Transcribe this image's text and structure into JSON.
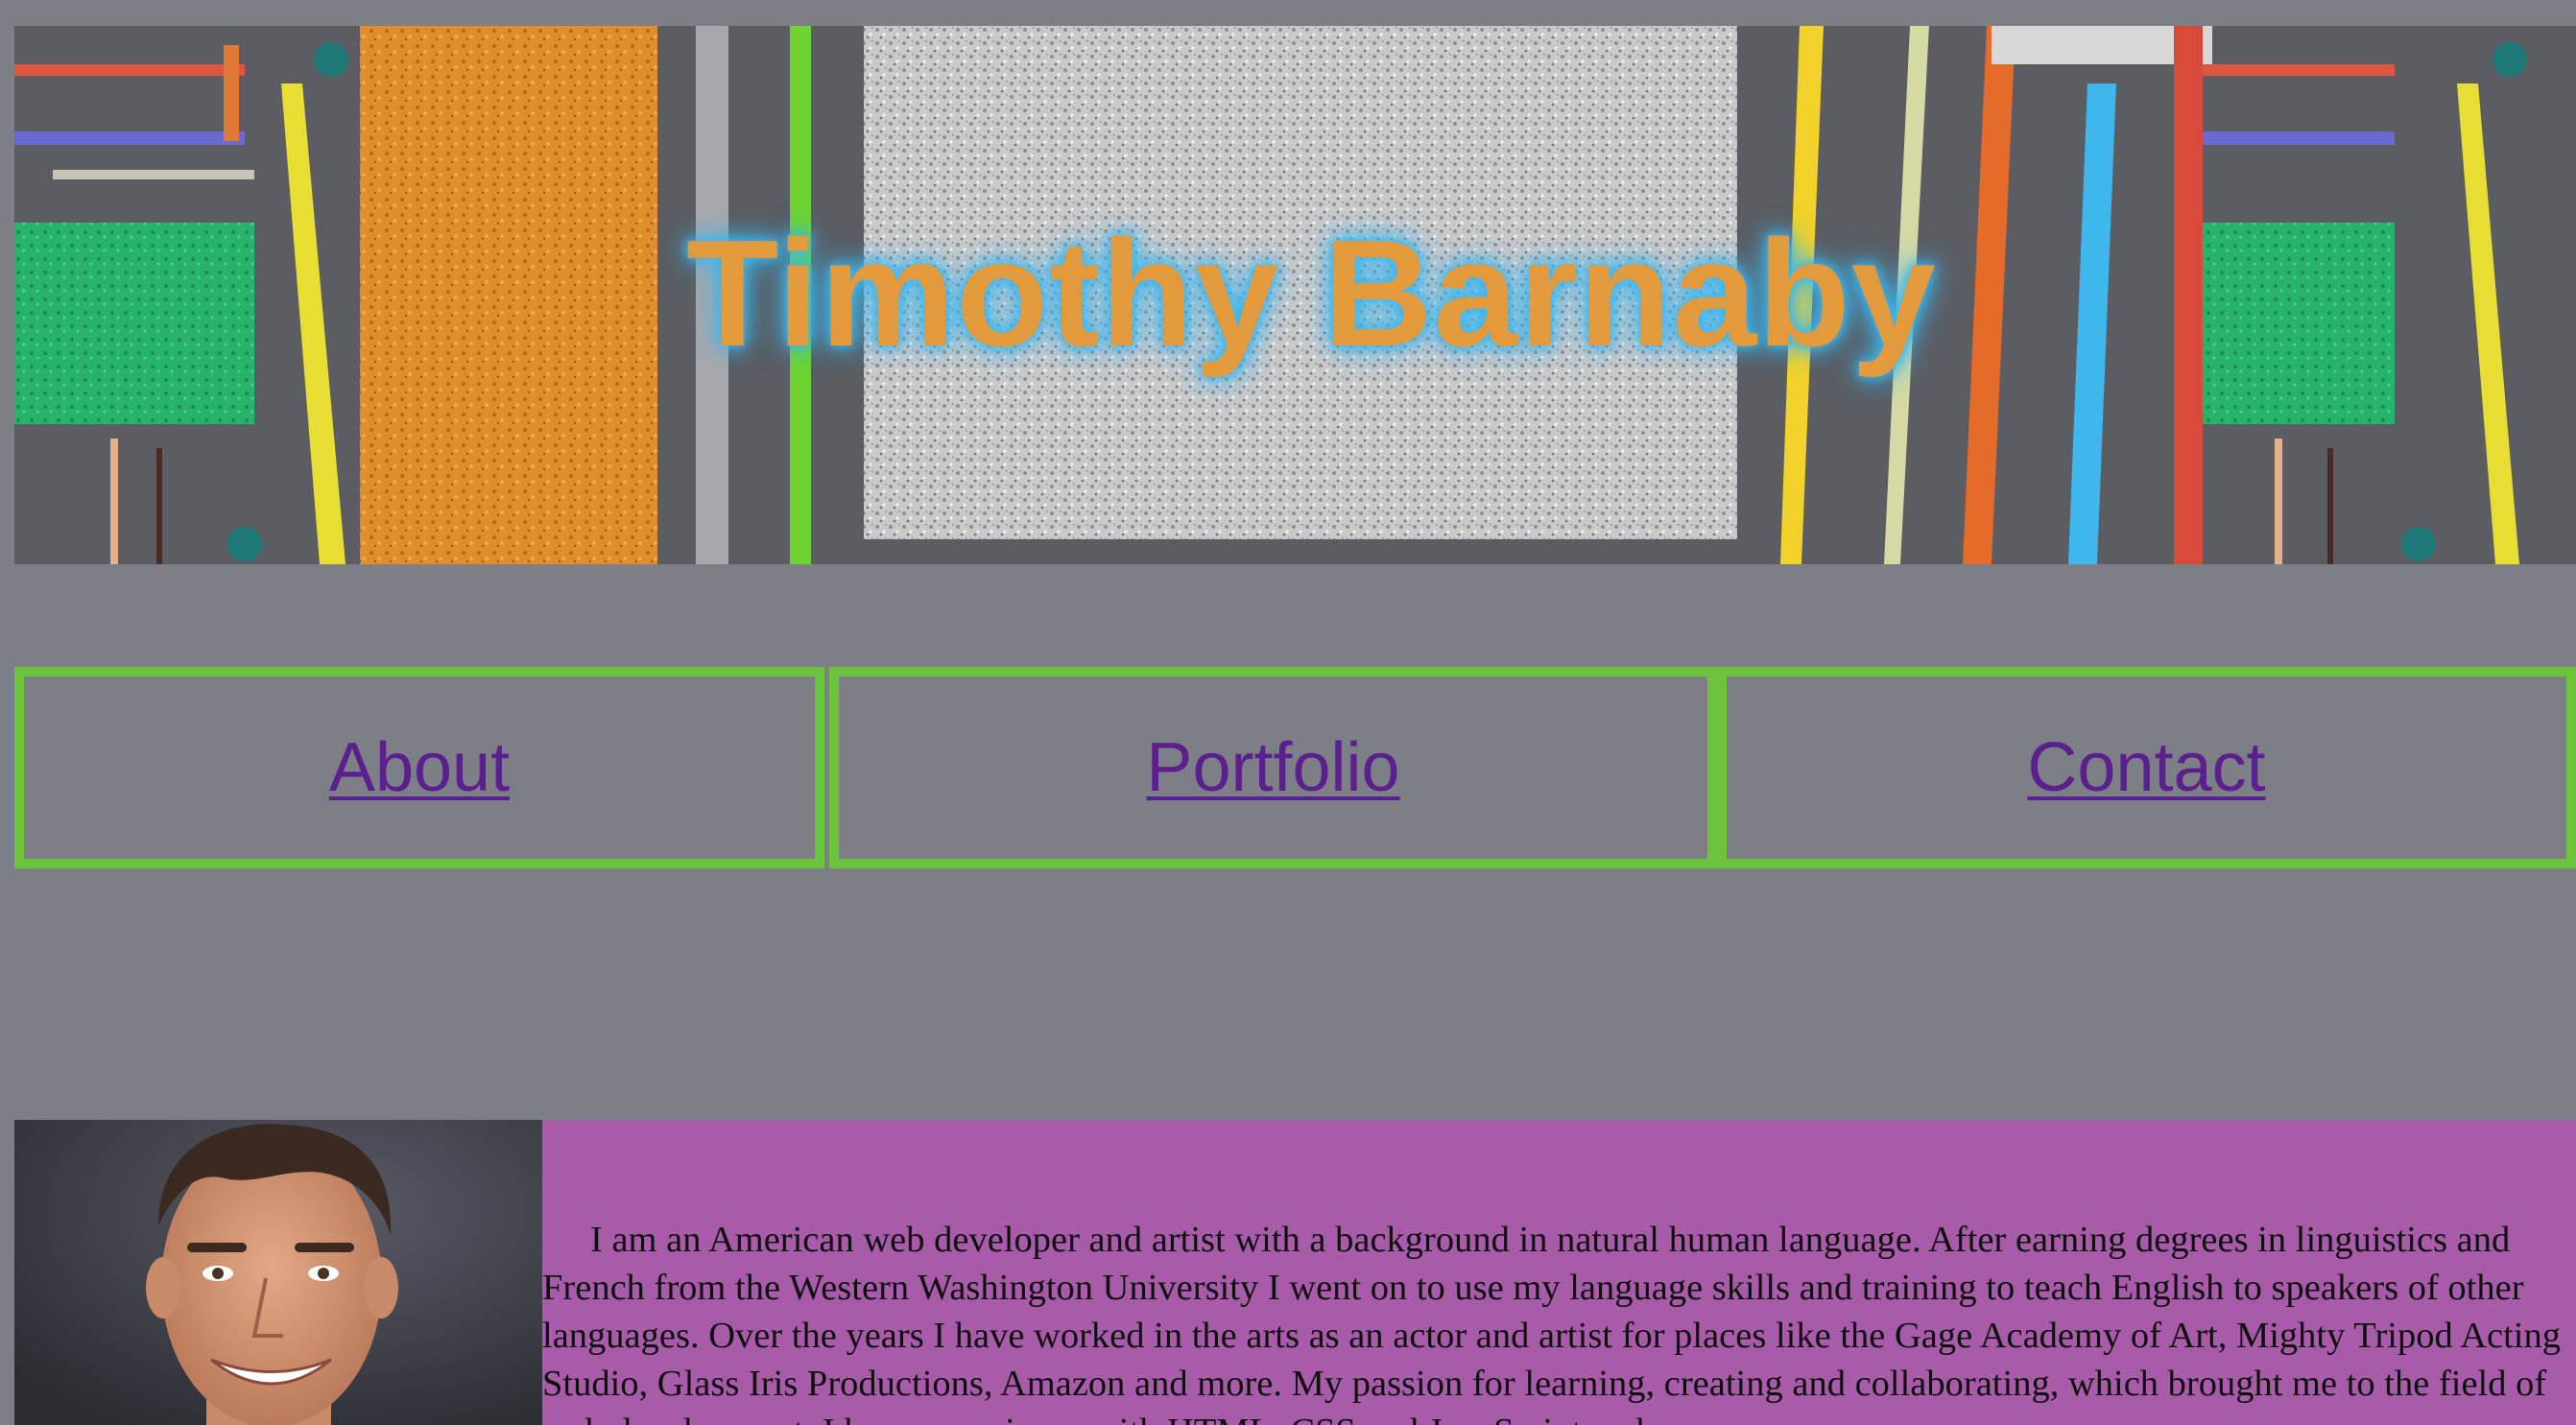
{
  "header": {
    "title": "Timothy Barnaby",
    "banner_image": "chalk-drawing-street-banner",
    "title_color": "#e39a3d",
    "title_glow_color": "#3ab6f0"
  },
  "nav": {
    "border_color": "#6dc43b",
    "link_color": "#5b1f8e",
    "items": [
      {
        "label": "About"
      },
      {
        "label": "Portfolio"
      },
      {
        "label": "Contact"
      }
    ]
  },
  "about": {
    "portrait_image": "headshot-smiling-man",
    "panel_color": "#a75ba8",
    "bio": "I am an American web developer and artist with a background in natural human language. After earning degrees in linguistics and French from the Western Washington University I went on to use my language skills and training to teach English to speakers of other languages. Over the years I have worked in the arts as an actor and artist for places like the Gage Academy of Art, Mighty Tripod Acting Studio, Glass Iris Productions, Amazon and more. My passion for learning, creating and collaborating, which brought me to the field of web development. I have experience with HTML, CSS and JavaScript and"
  },
  "page": {
    "background": "#7d7f86"
  }
}
